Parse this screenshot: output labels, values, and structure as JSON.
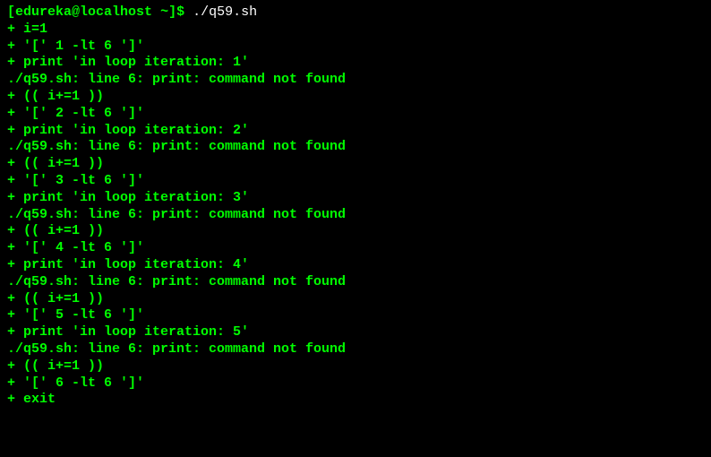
{
  "prompt": {
    "user": "edureka",
    "host": "localhost",
    "path": "~",
    "command": "./q59.sh"
  },
  "lines": [
    "+ i=1",
    "+ '[' 1 -lt 6 ']'",
    "+ print 'in loop iteration: 1'",
    "./q59.sh: line 6: print: command not found",
    "+ (( i+=1 ))",
    "+ '[' 2 -lt 6 ']'",
    "+ print 'in loop iteration: 2'",
    "./q59.sh: line 6: print: command not found",
    "+ (( i+=1 ))",
    "+ '[' 3 -lt 6 ']'",
    "+ print 'in loop iteration: 3'",
    "./q59.sh: line 6: print: command not found",
    "+ (( i+=1 ))",
    "+ '[' 4 -lt 6 ']'",
    "+ print 'in loop iteration: 4'",
    "./q59.sh: line 6: print: command not found",
    "+ (( i+=1 ))",
    "+ '[' 5 -lt 6 ']'",
    "+ print 'in loop iteration: 5'",
    "./q59.sh: line 6: print: command not found",
    "+ (( i+=1 ))",
    "+ '[' 6 -lt 6 ']'",
    "+ exit"
  ]
}
